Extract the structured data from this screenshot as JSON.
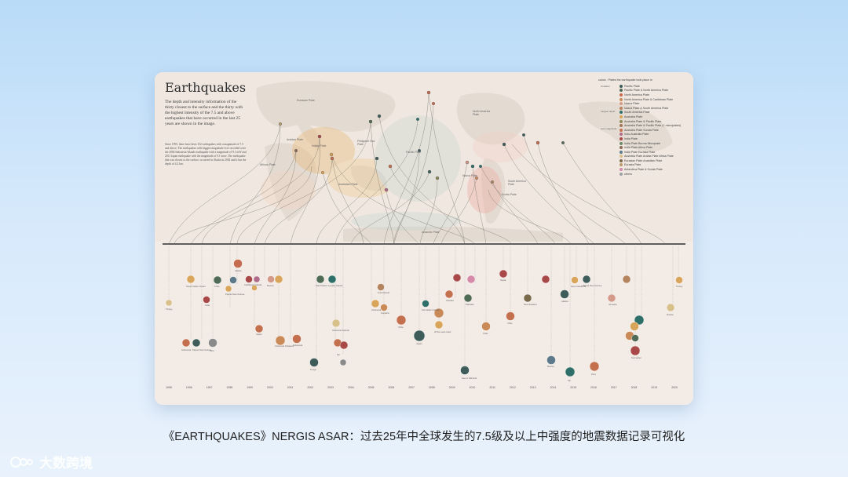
{
  "visualization": {
    "title": "Earthquakes",
    "intro": "The depth and intensity information of the thirty closest to the surface and the thirty with the highest intensity of the 7.5 and above earthquakes that have occurred in the last 25 years are shown in the image.",
    "body": "Since 1995, there have been 152 earthquakes with a magnitude of 7.5 and above. The earthquakes with biggest magnitude ever recorded were the 2004 Indonesia-Islands earthquake with a magnitude of 9.1 mW and 2011 Japan earthquake with the magnitude of 9.1 mwe. The earthquake that was closest to the surface, occurred in Alaska in 2002 and it has the depth of 4.2 km.",
    "legend": {
      "header": "colors : Plates the earthquake took place in",
      "scale_labels": [
        "Smallest",
        "Largest depth",
        "Low magnitude"
      ],
      "items": [
        {
          "label": "Pacific Plate",
          "color": "#3e5d5a"
        },
        {
          "label": "Pacific Plate & North America Plate",
          "color": "#4f6a55"
        },
        {
          "label": "North America Plate",
          "color": "#c56b4f"
        },
        {
          "label": "North America Plate & Caribbean Plate",
          "color": "#c98a57"
        },
        {
          "label": "Nazca Plate",
          "color": "#d39a8a"
        },
        {
          "label": "Nazca Plate & South America Plate",
          "color": "#b4845e"
        },
        {
          "label": "South America Plate",
          "color": "#2f6f6a"
        },
        {
          "label": "Australia Plate",
          "color": "#d9a55a"
        },
        {
          "label": "Australia Plate & Pacific Plate",
          "color": "#8c8a5a"
        },
        {
          "label": "Australia Plate & Pacific Plate (+ microplates)",
          "color": "#a27655"
        },
        {
          "label": "Australia Plate Sunda Plate",
          "color": "#c4704e"
        },
        {
          "label": "Indo-Australia Plate",
          "color": "#b06a8a"
        },
        {
          "label": "India Plate",
          "color": "#a84848"
        },
        {
          "label": "India Plate Burma Microplate",
          "color": "#6d8a6a"
        },
        {
          "label": "India Plate Africa Plate",
          "color": "#8a6a5a"
        },
        {
          "label": "India Plate Eurasia Plate",
          "color": "#5d7a8a"
        },
        {
          "label": "Australia Plate Arabia Plate Africa Plate",
          "color": "#d8c08a"
        },
        {
          "label": "Eurasian Plate Anatolian Plate",
          "color": "#7a6a4a"
        },
        {
          "label": "Eurasia Plate",
          "color": "#b89a6a"
        },
        {
          "label": "Antarctica Plate & Scotia Plate",
          "color": "#d48aa8"
        },
        {
          "label": "others",
          "color": "#9aa0a6"
        }
      ]
    },
    "plates": {
      "eurasian": "Eurasian Plate",
      "arabian": "Arabian Plate",
      "indian": "Indian Plate",
      "african": "African Plate",
      "philippine": "Philippine Sea Plate",
      "pacific": "Pacific Plate",
      "north_america": "North America Plate",
      "australian": "Australian Plate",
      "nazca": "Nazca Plate",
      "south_america": "South America Plate",
      "scotia": "Scotia Plate",
      "antarctic": "Antarctic Plate"
    },
    "years": [
      "1995",
      "1996",
      "1997",
      "1998",
      "1999",
      "2000",
      "2001",
      "2002",
      "2003",
      "2004",
      "2005",
      "2006",
      "2007",
      "2008",
      "2009",
      "2010",
      "2011",
      "2012",
      "2013",
      "2014",
      "2015",
      "2016",
      "2017",
      "2018",
      "2019",
      "2020"
    ]
  },
  "caption": "《EARTHQUAKES》NERGIS ASAR：过去25年中全球发生的7.5级及以上中强度的地震数据记录可视化",
  "watermark": "大数跨境"
}
